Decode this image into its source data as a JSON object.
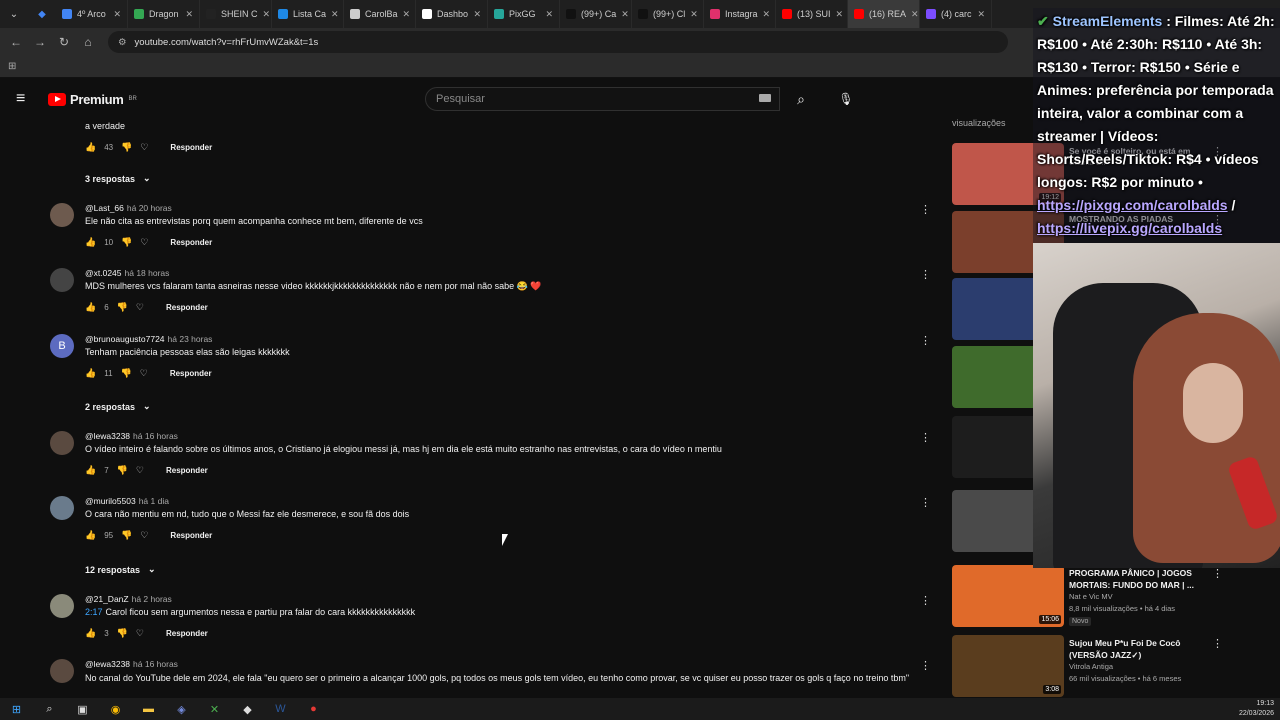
{
  "browser": {
    "tabs": [
      {
        "label": "4º Arco",
        "color": "#4285f4"
      },
      {
        "label": "Dragon",
        "color": "#34a853"
      },
      {
        "label": "SHEIN C",
        "color": "#222222"
      },
      {
        "label": "Lista Ca",
        "color": "#1e88e5"
      },
      {
        "label": "CarolBa",
        "color": "#cccccc"
      },
      {
        "label": "Dashbo",
        "color": "#ffffff"
      },
      {
        "label": "PixGG",
        "color": "#26a69a"
      },
      {
        "label": "(99+) Ca",
        "color": "#111111"
      },
      {
        "label": "(99+) Cl",
        "color": "#111111"
      },
      {
        "label": "Instagra",
        "color": "#e1306c"
      },
      {
        "label": "(13) SUI",
        "color": "#ff0000"
      },
      {
        "label": "(16) REA",
        "color": "#ff0000"
      },
      {
        "label": "(4) carc",
        "color": "#7c4dff"
      }
    ],
    "url": "youtube.com/watch?v=rhFrUmvWZak&t=1s"
  },
  "youtube": {
    "brand": "Premium",
    "region": "BR",
    "search_placeholder": "Pesquisar"
  },
  "comments": [
    {
      "text": "a verdade",
      "likes": "43",
      "reply": "Responder"
    },
    {
      "replies": "3 respostas"
    },
    {
      "user": "@Last_66",
      "time": "há 20 horas",
      "text": "Ele não cita as entrevistas porq quem acompanha conhece mt bem, diferente de vcs",
      "likes": "10",
      "reply": "Responder"
    },
    {
      "user": "@xt.0245",
      "time": "há 18 horas",
      "text": "MDS mulheres vcs falaram tanta asneiras nesse video kkkkkkjkkkkkkkkkkkkkk não e nem por mal não sabe 😂 ❤️",
      "likes": "6",
      "reply": "Responder"
    },
    {
      "user": "@brunoaugusto7724",
      "time": "há 23 horas",
      "text": "Tenham paciência pessoas elas são leigas kkkkkkk",
      "likes": "11",
      "reply": "Responder",
      "letter": "B"
    },
    {
      "replies": "2 respostas"
    },
    {
      "user": "@lewa3238",
      "time": "há 16 horas",
      "text": "O vídeo inteiro é falando sobre os últimos anos, o Cristiano já elogiou messi já, mas hj em dia ele está muito estranho nas entrevistas, o cara do vídeo n mentiu",
      "likes": "7",
      "reply": "Responder"
    },
    {
      "user": "@murilo5503",
      "time": "há 1 dia",
      "text": "O cara não mentiu em nd, tudo que o Messi faz ele desmerece,  e sou fã dos dois",
      "likes": "95",
      "reply": "Responder"
    },
    {
      "replies": "12 respostas"
    },
    {
      "user": "@21_DanZ",
      "time": "há 2 horas",
      "timestamp": "2:17",
      "text": "Carol ficou sem argumentos nessa e partiu pra falar do cara kkkkkkkkkkkkkkk",
      "likes": "3",
      "reply": "Responder"
    },
    {
      "user": "@lewa3238",
      "time": "há 16 horas",
      "text": "No canal do YouTube dele em 2024, ele fala \"eu quero ser o primeiro a alcançar 1000 gols, pq todos os meus gols tem vídeo, eu tenho como provar, se vc quiser eu posso trazer os gols q faço no treino tbm\""
    }
  ],
  "sidebar": {
    "label": "visualizações",
    "videos": [
      {
        "title": "Se você é solteiro, ou está em",
        "meta": "Gabrita Off",
        "duration": "19:12",
        "color": "#c0564a"
      },
      {
        "title": "MOSTRANDO AS PIADAS",
        "meta": "",
        "duration": "",
        "color": "#7b3f2c"
      },
      {
        "title": "",
        "meta": "",
        "duration": "",
        "color": "#2b3d6e"
      },
      {
        "title": "",
        "meta": "",
        "duration": "",
        "color": "#3f6b2c"
      },
      {
        "title": "",
        "meta": "",
        "duration": "",
        "color": "#1d1d1d"
      },
      {
        "title": "",
        "meta": "",
        "duration": "",
        "color": "#4a4a4a"
      },
      {
        "title": "PROGRAMA PÂNICO | JOGOS MORTAIS: FUNDO DO MAR | ...",
        "meta": "Nat e Vic MV",
        "meta2": "8,8 mil visualizações • há 4 dias",
        "badge": "Novo",
        "duration": "15:06",
        "color": "#e06a2a"
      },
      {
        "title": "Sujou Meu P*u Foi De Cocô (VERSÃO JAZZ✓)",
        "meta": "Vitrola Antiga",
        "meta2": "66 mil visualizações • há 6 meses",
        "duration": "3:08",
        "color": "#5a3d1e"
      }
    ]
  },
  "stream_overlay": {
    "source": "StreamElements",
    "text": ": Filmes: Até 2h: R$100 • Até 2:30h: R$110 • Até 3h: R$130 • Terror: R$150 • Série e Animes: preferência por temporada inteira, valor a combinar com a streamer | Vídeos: Shorts/Reels/Tiktok: R$4 • vídeos longos: R$2 por minuto •",
    "link1": "https://pixgg.com/carolbalds",
    "sep": "/",
    "link2": "https://livepix.gg/carolbalds"
  },
  "taskbar": {
    "time": "19:13",
    "date": "22/03/2026"
  }
}
